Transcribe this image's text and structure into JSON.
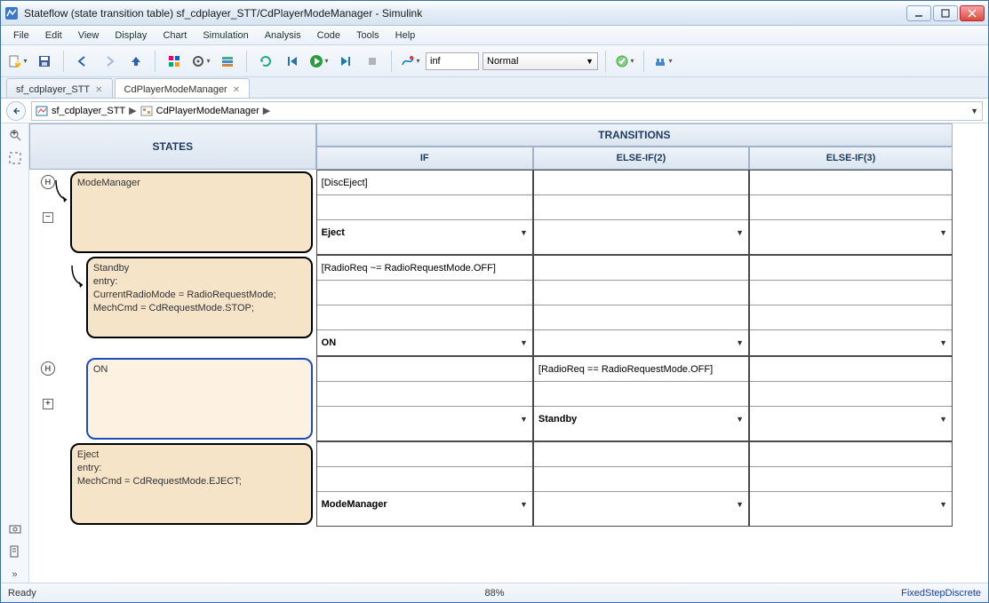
{
  "window": {
    "title": "Stateflow (state transition table) sf_cdplayer_STT/CdPlayerModeManager - Simulink"
  },
  "menu": {
    "items": [
      "File",
      "Edit",
      "View",
      "Display",
      "Chart",
      "Simulation",
      "Analysis",
      "Code",
      "Tools",
      "Help"
    ]
  },
  "toolbar": {
    "stop_time": "inf",
    "mode": "Normal"
  },
  "tabs": {
    "items": [
      {
        "label": "sf_cdplayer_STT",
        "active": false
      },
      {
        "label": "CdPlayerModeManager",
        "active": true
      }
    ]
  },
  "breadcrumb": {
    "items": [
      "sf_cdplayer_STT",
      "CdPlayerModeManager"
    ]
  },
  "headers": {
    "states": "STATES",
    "transitions": "TRANSITIONS",
    "if": "IF",
    "elseif2": "ELSE-IF(2)",
    "elseif3": "ELSE-IF(3)"
  },
  "states": [
    {
      "name": "ModeManager",
      "body": "",
      "gutter": {
        "hist": true,
        "expand": "-"
      },
      "cols": {
        "if": {
          "cond": "[DiscEject]",
          "act": "",
          "dest": "Eject"
        },
        "e2": {
          "cond": "",
          "act": "",
          "dest": ""
        },
        "e3": {
          "cond": "",
          "act": "",
          "dest": ""
        }
      }
    },
    {
      "name": "Standby",
      "body": "entry:\nCurrentRadioMode = RadioRequestMode;\nMechCmd = CdRequestMode.STOP;",
      "gutter": {
        "hist": false,
        "expand": ""
      },
      "cols": {
        "if": {
          "cond": "[RadioReq ~= RadioRequestMode.OFF]",
          "act": "",
          "dest": "ON"
        },
        "e2": {
          "cond": "",
          "act": "",
          "dest": ""
        },
        "e3": {
          "cond": "",
          "act": "",
          "dest": ""
        }
      }
    },
    {
      "name": "ON",
      "body": "",
      "gutter": {
        "hist": true,
        "expand": "+"
      },
      "selected": true,
      "cols": {
        "if": {
          "cond": "",
          "act": "",
          "dest": ""
        },
        "e2": {
          "cond": "[RadioReq == RadioRequestMode.OFF]",
          "act": "",
          "dest": "Standby"
        },
        "e3": {
          "cond": "",
          "act": "",
          "dest": ""
        }
      }
    },
    {
      "name": "Eject",
      "body": "entry:\nMechCmd = CdRequestMode.EJECT;",
      "gutter": {
        "hist": false,
        "expand": ""
      },
      "cols": {
        "if": {
          "cond": "",
          "act": "",
          "dest": "ModeManager"
        },
        "e2": {
          "cond": "",
          "act": "",
          "dest": ""
        },
        "e3": {
          "cond": "",
          "act": "",
          "dest": ""
        }
      }
    }
  ],
  "status": {
    "left": "Ready",
    "mid": "88%",
    "right": "FixedStepDiscrete"
  }
}
